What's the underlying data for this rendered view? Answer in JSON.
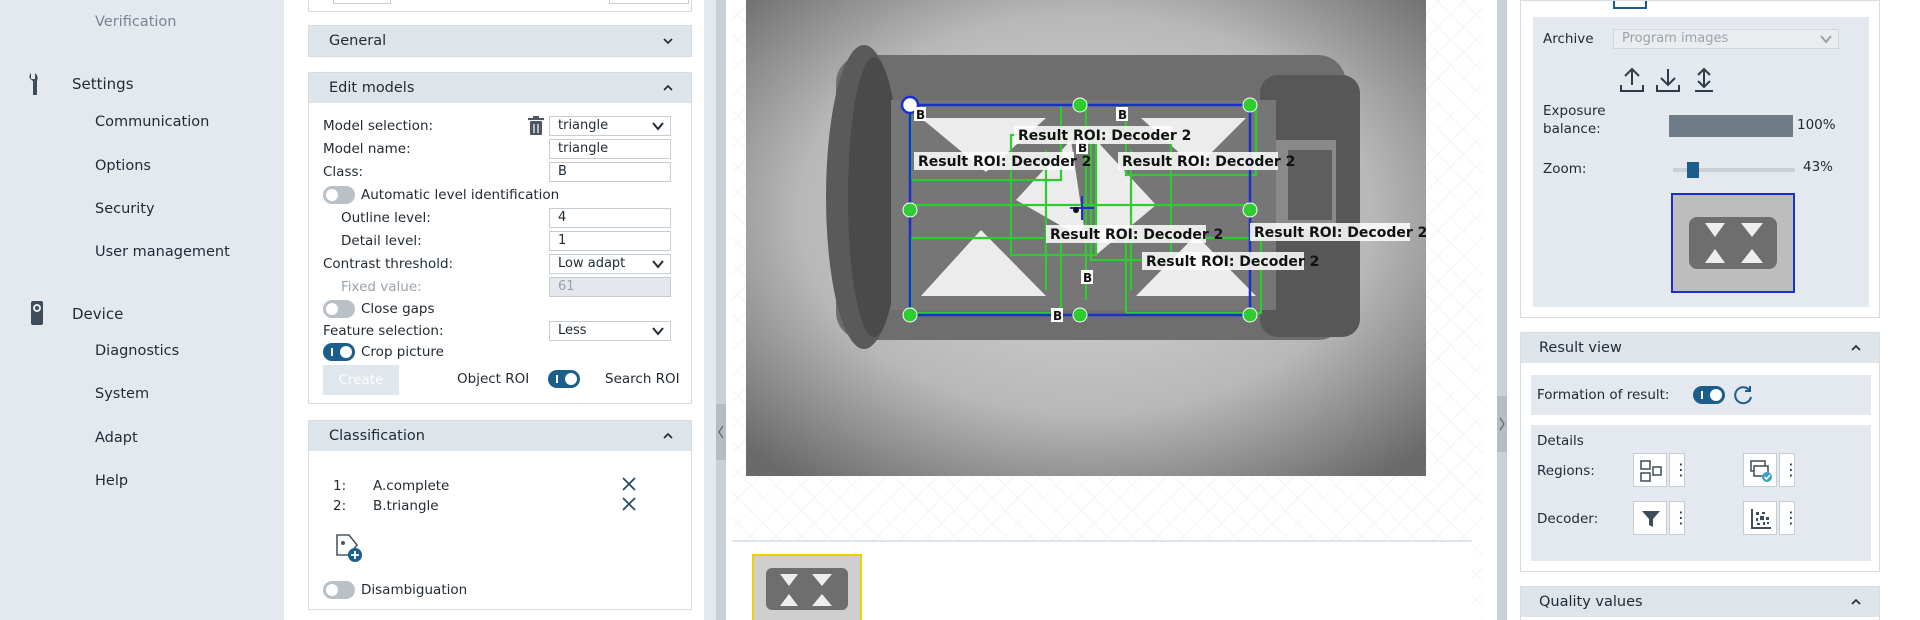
{
  "nav": {
    "top_item": "Verification",
    "settings": {
      "label": "Settings",
      "items": [
        "Communication",
        "Options",
        "Security",
        "User management"
      ]
    },
    "device": {
      "label": "Device",
      "items": [
        "Diagnostics",
        "System",
        "Adapt",
        "Help"
      ]
    }
  },
  "general": {
    "title": "General"
  },
  "edit_models": {
    "title": "Edit models",
    "model_selection_label": "Model selection:",
    "model_selection_value": "triangle",
    "model_name_label": "Model name:",
    "model_name_value": "triangle",
    "class_label": "Class:",
    "class_value": "B",
    "auto_level_label": "Automatic level identification",
    "outline_label": "Outline level:",
    "outline_value": "4",
    "detail_label": "Detail level:",
    "detail_value": "1",
    "contrast_label": "Contrast threshold:",
    "contrast_value": "Low adapt",
    "fixed_label": "Fixed value:",
    "fixed_value": "61",
    "close_gaps_label": "Close gaps",
    "feature_label": "Feature selection:",
    "feature_value": "Less",
    "crop_label": "Crop picture",
    "create_label": "Create",
    "object_roi_label": "Object ROI",
    "search_roi_label": "Search ROI"
  },
  "classification": {
    "title": "Classification",
    "items": [
      {
        "num": "1:",
        "label": "A.complete"
      },
      {
        "num": "2:",
        "label": "B.triangle"
      }
    ],
    "disambiguation_label": "Disambiguation"
  },
  "overlay": {
    "decoder_labels": [
      "Result ROI:  Decoder 2",
      "Result ROI:  Decoder 2",
      "Result ROI:  Decoder 2",
      "Result ROI:  Decoder 2",
      "Result ROI:  Decoder 2",
      "Result ROI:  Decoder 2"
    ],
    "class_marks": [
      "B",
      "B",
      "B",
      "B",
      "B"
    ]
  },
  "right": {
    "archive_label": "Archive",
    "archive_value": "Program images",
    "exposure_label_line1": "Exposure",
    "exposure_label_line2": "balance:",
    "exposure_value": "100%",
    "exposure_fraction": 1.0,
    "zoom_label": "Zoom:",
    "zoom_value": "43%",
    "zoom_fraction": 0.13,
    "result_view_title": "Result view",
    "formation_label": "Formation of result:",
    "details_label": "Details",
    "regions_label": "Regions:",
    "decoder_label": "Decoder:",
    "quality_title": "Quality values"
  },
  "colors": {
    "accent": "#1b5e8c",
    "roi_green": "#2ecc2e",
    "roi_blue": "#1a2fd0",
    "panel_bg": "#e3e9ee",
    "thumb_border": "#f0d000"
  }
}
